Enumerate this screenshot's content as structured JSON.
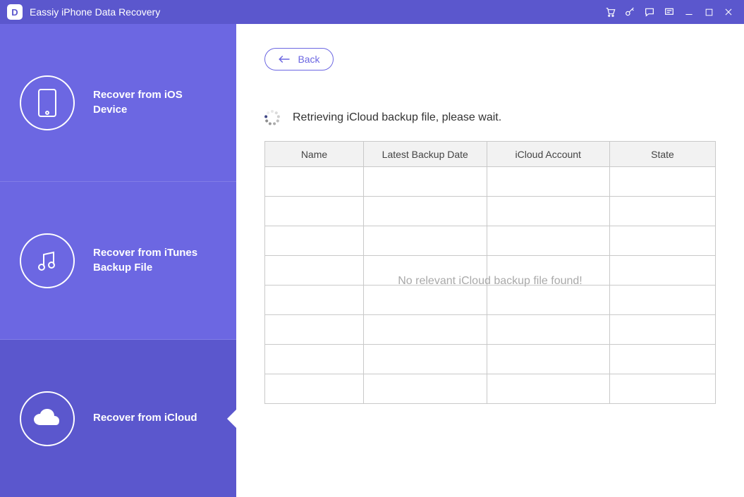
{
  "app_title": "Eassiy iPhone Data Recovery",
  "titlebar_icons": [
    "cart",
    "key",
    "chat",
    "feedback",
    "minimize",
    "maximize",
    "close"
  ],
  "sidebar": {
    "items": [
      {
        "label": "Recover from iOS Device",
        "icon": "phone-icon"
      },
      {
        "label": "Recover from iTunes Backup File",
        "icon": "music-note-icon"
      },
      {
        "label": "Recover from iCloud",
        "icon": "cloud-icon"
      }
    ],
    "active_index": 2
  },
  "main": {
    "back_label": "Back",
    "status_text": "Retrieving iCloud backup file, please wait.",
    "table": {
      "headers": [
        "Name",
        "Latest Backup Date",
        "iCloud Account",
        "State"
      ],
      "rows": [
        [
          "",
          "",
          "",
          ""
        ],
        [
          "",
          "",
          "",
          ""
        ],
        [
          "",
          "",
          "",
          ""
        ],
        [
          "",
          "",
          "",
          ""
        ],
        [
          "",
          "",
          "",
          ""
        ],
        [
          "",
          "",
          "",
          ""
        ],
        [
          "",
          "",
          "",
          ""
        ],
        [
          "",
          "",
          "",
          ""
        ]
      ],
      "empty_message": "No relevant iCloud backup file found!"
    }
  }
}
